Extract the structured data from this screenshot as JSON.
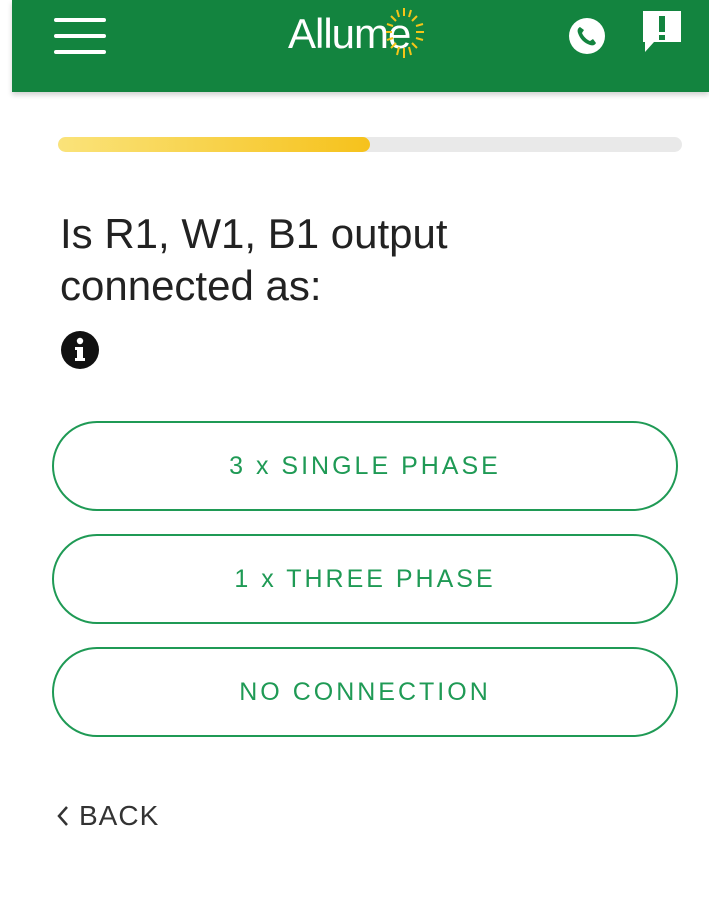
{
  "header": {
    "logo_text": "Allume",
    "background_color": "#13843f",
    "icons": {
      "menu": "hamburger-menu-icon",
      "phone": "phone-icon",
      "feedback": "feedback-icon"
    }
  },
  "progress": {
    "fraction": 0.5,
    "fill_color": "#f6c21c",
    "track_color": "#e9e9e9"
  },
  "question": {
    "line1": "Is R1, W1, B1 output",
    "line2": "connected as:",
    "info_icon": "info-icon"
  },
  "options": [
    {
      "label": "3 x SINGLE PHASE"
    },
    {
      "label": "1 x THREE PHASE"
    },
    {
      "label": "NO CONNECTION"
    }
  ],
  "back": {
    "label": "BACK",
    "icon": "chevron-left-icon"
  },
  "colors": {
    "accent": "#1f9a55",
    "text": "#222222"
  }
}
